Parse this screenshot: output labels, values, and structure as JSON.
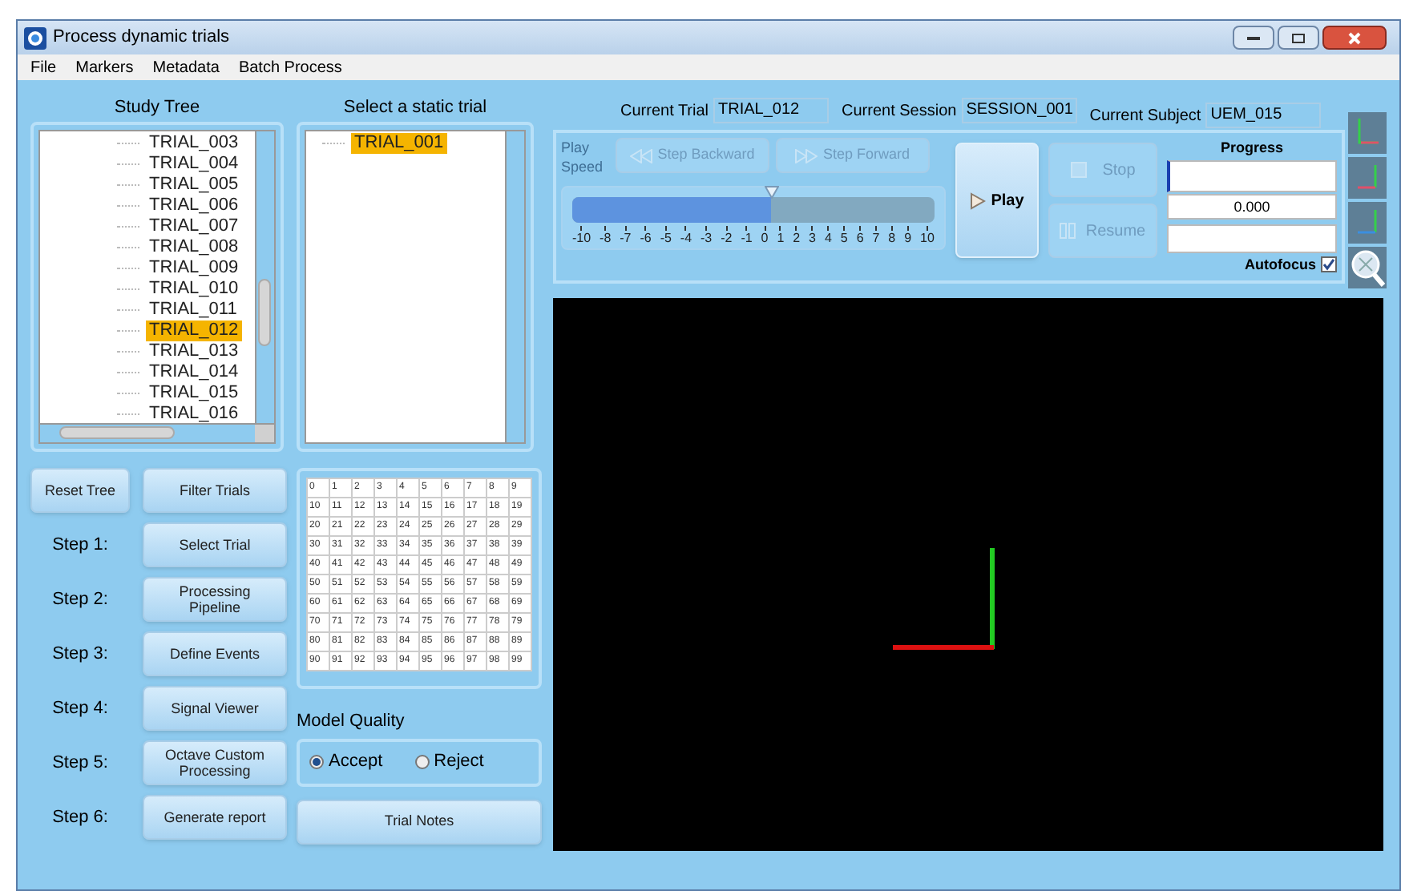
{
  "window": {
    "title": "Process dynamic trials"
  },
  "menu": [
    "File",
    "Markers",
    "Metadata",
    "Batch Process"
  ],
  "study_tree": {
    "title": "Study Tree",
    "items": [
      {
        "label": "TRIAL_003",
        "selected": false
      },
      {
        "label": "TRIAL_004",
        "selected": false
      },
      {
        "label": "TRIAL_005",
        "selected": false
      },
      {
        "label": "TRIAL_006",
        "selected": false
      },
      {
        "label": "TRIAL_007",
        "selected": false
      },
      {
        "label": "TRIAL_008",
        "selected": false
      },
      {
        "label": "TRIAL_009",
        "selected": false
      },
      {
        "label": "TRIAL_010",
        "selected": false
      },
      {
        "label": "TRIAL_011",
        "selected": false
      },
      {
        "label": "TRIAL_012",
        "selected": true
      },
      {
        "label": "TRIAL_013",
        "selected": false
      },
      {
        "label": "TRIAL_014",
        "selected": false
      },
      {
        "label": "TRIAL_015",
        "selected": false
      },
      {
        "label": "TRIAL_016",
        "selected": false
      }
    ]
  },
  "static_trial": {
    "title": "Select a static trial",
    "items": [
      {
        "label": "TRIAL_001",
        "selected": true
      }
    ]
  },
  "tree_buttons": [
    "Reset Tree",
    "Filter Trials"
  ],
  "steps": [
    {
      "label": "Step 1:",
      "button": "Select Trial"
    },
    {
      "label": "Step 2:",
      "button": "Processing Pipeline"
    },
    {
      "label": "Step 3:",
      "button": "Define Events"
    },
    {
      "label": "Step 4:",
      "button": "Signal Viewer"
    },
    {
      "label": "Step 5:",
      "button": "Octave Custom Processing"
    },
    {
      "label": "Step 6:",
      "button": "Generate report"
    }
  ],
  "marker_grid": [
    [
      "0",
      "1",
      "2",
      "3",
      "4",
      "5",
      "6",
      "7",
      "8",
      "9"
    ],
    [
      "10",
      "11",
      "12",
      "13",
      "14",
      "15",
      "16",
      "17",
      "18",
      "19"
    ],
    [
      "20",
      "21",
      "22",
      "23",
      "24",
      "25",
      "26",
      "27",
      "28",
      "29"
    ],
    [
      "30",
      "31",
      "32",
      "33",
      "34",
      "35",
      "36",
      "37",
      "38",
      "39"
    ],
    [
      "40",
      "41",
      "42",
      "43",
      "44",
      "45",
      "46",
      "47",
      "48",
      "49"
    ],
    [
      "50",
      "51",
      "52",
      "53",
      "54",
      "55",
      "56",
      "57",
      "58",
      "59"
    ],
    [
      "60",
      "61",
      "62",
      "63",
      "64",
      "65",
      "66",
      "67",
      "68",
      "69"
    ],
    [
      "70",
      "71",
      "72",
      "73",
      "74",
      "75",
      "76",
      "77",
      "78",
      "79"
    ],
    [
      "80",
      "81",
      "82",
      "83",
      "84",
      "85",
      "86",
      "87",
      "88",
      "89"
    ],
    [
      "90",
      "91",
      "92",
      "93",
      "94",
      "95",
      "96",
      "97",
      "98",
      "99"
    ]
  ],
  "model_quality": {
    "title": "Model Quality",
    "options": [
      {
        "label": "Accept",
        "selected": true
      },
      {
        "label": "Reject",
        "selected": false
      }
    ]
  },
  "trial_notes_button": "Trial Notes",
  "current": [
    {
      "label": "Current Trial",
      "value": "TRIAL_012"
    },
    {
      "label": "Current Session",
      "value": "SESSION_001"
    },
    {
      "label": "Current Subject",
      "value": "UEM_015"
    }
  ],
  "playback": {
    "speed_label": "Play Speed",
    "buttons": [
      {
        "kind": "back",
        "label": "Step Backward",
        "disabled": true
      },
      {
        "kind": "forward",
        "label": "Step Forward",
        "disabled": true
      }
    ],
    "slider": {
      "level": 0.55,
      "ticks": [
        "-10",
        "-8",
        "-7",
        "-6",
        "-5",
        "-4",
        "-3",
        "-2",
        "-1",
        "0",
        "1",
        "2",
        "3",
        "4",
        "5",
        "6",
        "7",
        "8",
        "9",
        "10"
      ]
    },
    "play": {
      "label": "Play",
      "disabled": false
    },
    "stop": {
      "label": "Stop",
      "disabled": true
    },
    "resume": {
      "label": "Resume",
      "disabled": true
    },
    "progress": {
      "title": "Progress",
      "value": "0.000"
    },
    "autofocus": {
      "label": "Autofocus",
      "checked": true
    }
  }
}
